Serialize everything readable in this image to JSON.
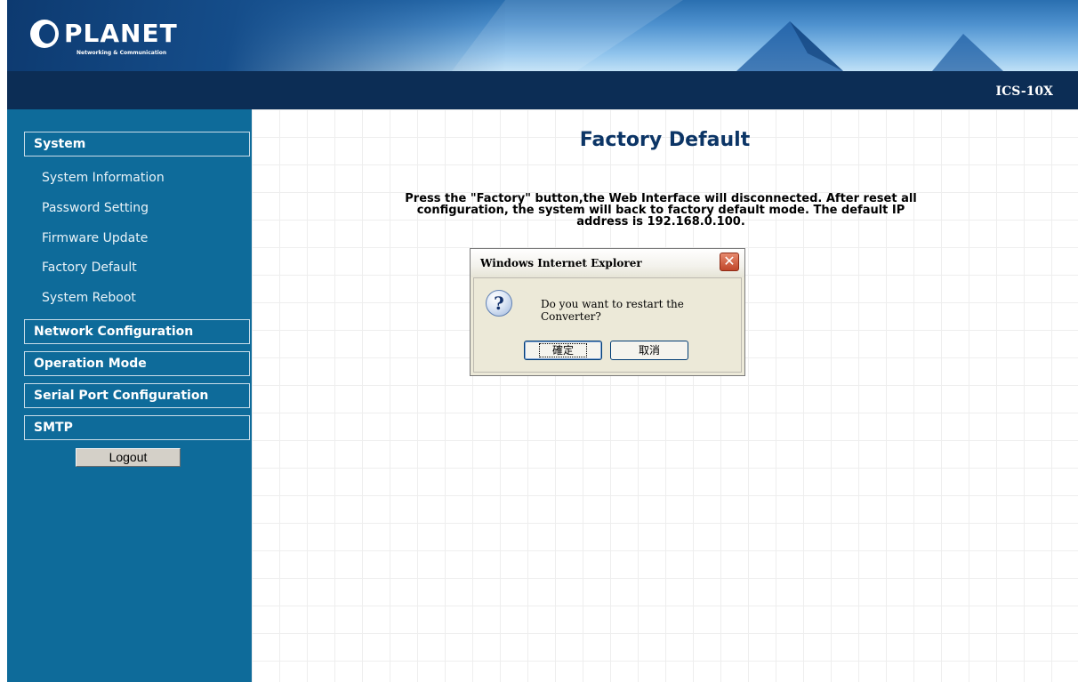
{
  "header": {
    "logo_text": "PLANET",
    "logo_tagline": "Networking & Communication",
    "model": "ICS-10X"
  },
  "sidebar": {
    "sections": [
      {
        "label": "System"
      },
      {
        "label": "Network Configuration"
      },
      {
        "label": "Operation Mode"
      },
      {
        "label": "Serial Port Configuration"
      },
      {
        "label": "SMTP"
      }
    ],
    "system_items": [
      {
        "label": "System Information"
      },
      {
        "label": "Password Setting"
      },
      {
        "label": "Firmware Update"
      },
      {
        "label": "Factory Default"
      },
      {
        "label": "System Reboot"
      }
    ],
    "logout_label": "Logout"
  },
  "main": {
    "title": "Factory Default",
    "message": "Press the \"Factory\" button,the Web Interface will disconnected. After reset all configuration, the system will back to factory default mode. The default IP address is 192.168.0.100."
  },
  "dialog": {
    "title": "Windows Internet Explorer",
    "close_glyph": "✕",
    "icon": "question-icon",
    "icon_glyph": "?",
    "message": "Do you want to restart the Converter?",
    "ok_label": "確定",
    "cancel_label": "取消"
  },
  "colors": {
    "sidebar_bg": "#0e6b9a",
    "navbar_bg": "#0c2d55",
    "title_color": "#0c3566"
  }
}
